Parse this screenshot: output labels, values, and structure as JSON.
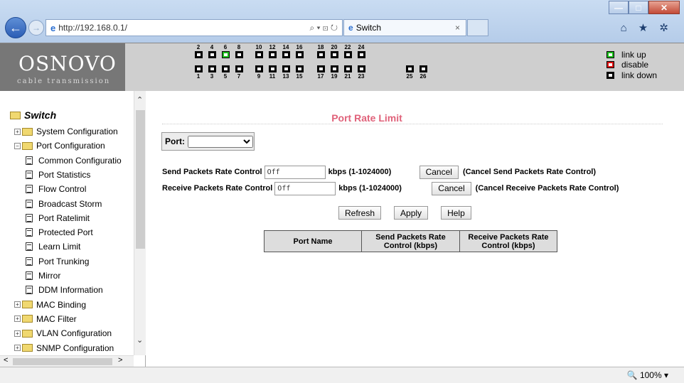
{
  "browser": {
    "url": "http://192.168.0.1/",
    "tab_title": "Switch",
    "tab_close": "×",
    "search_glyph": "⌕ ▾ ⊡ ↻",
    "window_controls": [
      "—",
      "□",
      "✕"
    ],
    "fav_icons": "⌂ ★ ✲",
    "back_glyph": "←",
    "forward_glyph": "→",
    "ie_glyph": "e"
  },
  "header": {
    "brand": "OSNOVO",
    "tagline": "cable transmission",
    "top_port_numbers": [
      "2",
      "4",
      "6",
      "8",
      "10",
      "12",
      "14",
      "16",
      "18",
      "20",
      "22",
      "24"
    ],
    "bottom_port_numbers": [
      "1",
      "3",
      "5",
      "7",
      "9",
      "11",
      "13",
      "15",
      "17",
      "19",
      "21",
      "23",
      "25",
      "26"
    ],
    "legend": [
      {
        "label": "link up",
        "state": "up"
      },
      {
        "label": "disable",
        "state": "disable"
      },
      {
        "label": "link down",
        "state": "down"
      }
    ],
    "colors": {
      "link_up": "#1bbd1b",
      "disable": "#dd1111",
      "link_down": "#000000"
    }
  },
  "nav": {
    "root": "Switch",
    "items": [
      {
        "label": "System Configuration",
        "type": "folder"
      },
      {
        "label": "Port Configuration",
        "type": "folder-open"
      },
      {
        "label": "Common Configuratio",
        "type": "page"
      },
      {
        "label": "Port Statistics",
        "type": "page"
      },
      {
        "label": "Flow Control",
        "type": "page"
      },
      {
        "label": "Broadcast Storm",
        "type": "page"
      },
      {
        "label": "Port Ratelimit",
        "type": "page"
      },
      {
        "label": "Protected Port",
        "type": "page"
      },
      {
        "label": "Learn Limit",
        "type": "page"
      },
      {
        "label": "Port Trunking",
        "type": "page"
      },
      {
        "label": "Mirror",
        "type": "page"
      },
      {
        "label": "DDM Information",
        "type": "page"
      },
      {
        "label": "MAC Binding",
        "type": "folder"
      },
      {
        "label": "MAC Filter",
        "type": "folder"
      },
      {
        "label": "VLAN Configuration",
        "type": "folder"
      },
      {
        "label": "SNMP Configuration",
        "type": "folder"
      }
    ]
  },
  "main": {
    "title": "Port Rate Limit",
    "port_label": "Port:",
    "port_value": "",
    "send": {
      "label": "Send Packets Rate Control",
      "value": "Off",
      "unit": "kbps (1-1024000)",
      "cancel": "Cancel",
      "cancel_note": "(Cancel Send Packets Rate Control)"
    },
    "receive": {
      "label": "Receive Packets Rate Control",
      "value": "Off",
      "unit": "kbps (1-1024000)",
      "cancel": "Cancel",
      "cancel_note": "(Cancel Receive Packets Rate Control)"
    },
    "buttons": {
      "refresh": "Refresh",
      "apply": "Apply",
      "help": "Help"
    },
    "table": {
      "headers": [
        "Port Name",
        "Send Packets Rate Control (kbps)",
        "Receive Packets Rate Control (kbps)"
      ]
    },
    "title_color": "#e0627a"
  },
  "status": {
    "zoom": "🔍 100%  ▾"
  }
}
